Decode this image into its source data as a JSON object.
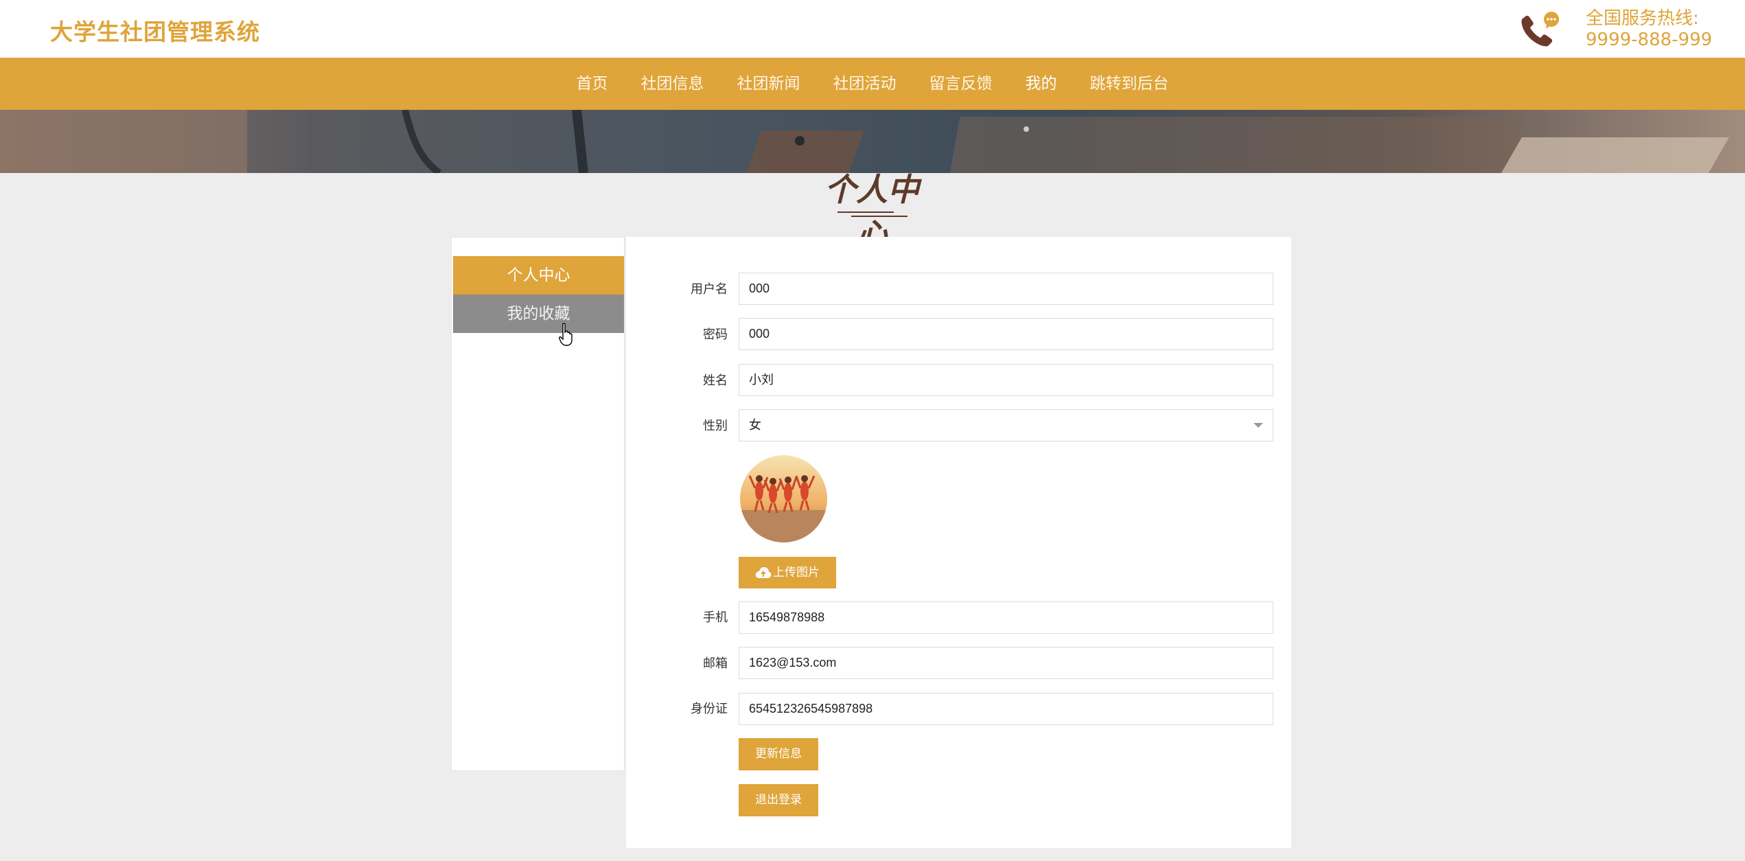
{
  "header": {
    "brand": "大学生社团管理系统",
    "hotline_label": "全国服务热线:",
    "hotline_number": "9999-888-999"
  },
  "nav": {
    "items": [
      "首页",
      "社团信息",
      "社团新闻",
      "社团活动",
      "留言反馈",
      "我的",
      "跳转到后台"
    ],
    "active": "我的"
  },
  "page": {
    "title": "个人中心"
  },
  "sidebar": {
    "items": [
      {
        "label": "个人中心",
        "active": true
      },
      {
        "label": "我的收藏",
        "active": false
      }
    ]
  },
  "form": {
    "username": {
      "label": "用户名",
      "value": "000"
    },
    "password": {
      "label": "密码",
      "value": "000"
    },
    "name": {
      "label": "姓名",
      "value": "小刘"
    },
    "gender": {
      "label": "性别",
      "value": "女"
    },
    "upload_label": "上传图片",
    "phone": {
      "label": "手机",
      "value": "16549878988"
    },
    "email": {
      "label": "邮箱",
      "value": "1623@153.com"
    },
    "id_card": {
      "label": "身份证",
      "value": "654512326545987898"
    },
    "update_label": "更新信息",
    "logout_label": "退出登录"
  },
  "colors": {
    "accent": "#dfa43a",
    "title": "#5e3a2a",
    "sidebar_inactive": "#8c8c8c",
    "page_bg": "#ededed"
  },
  "icons": [
    "phone-chat-icon",
    "cloud-upload-icon",
    "chevron-down-icon",
    "hand-pointer-icon"
  ]
}
